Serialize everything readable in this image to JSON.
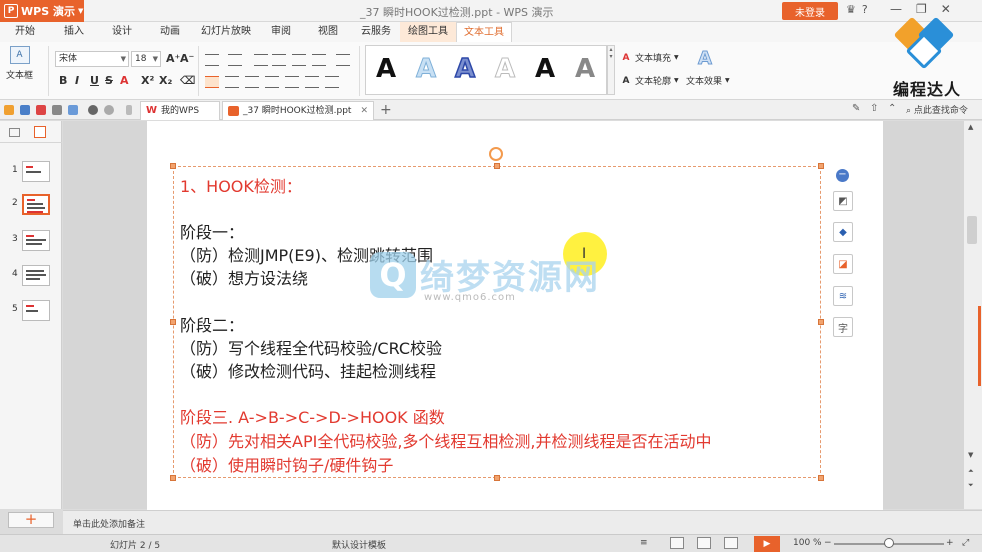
{
  "titlebar": {
    "app_name": "WPS 演示",
    "doc_title": "_37 瞬时HOOK过检测.ppt - WPS 演示",
    "login_label": "未登录",
    "help_label": "?"
  },
  "ribbon_tabs": [
    {
      "label": "开始"
    },
    {
      "label": "插入"
    },
    {
      "label": "设计"
    },
    {
      "label": "动画"
    },
    {
      "label": "幻灯片放映"
    },
    {
      "label": "审阅"
    },
    {
      "label": "视图"
    },
    {
      "label": "云服务"
    },
    {
      "label": "绘图工具"
    },
    {
      "label": "文本工具"
    }
  ],
  "ribbon": {
    "textbox_label": "文本框",
    "font_name": "宋体",
    "font_size": "18",
    "style_sample": "A",
    "text_fill_label": "文本填充",
    "text_outline_label": "文本轮廓",
    "text_effect_label": "文本效果"
  },
  "doc_tabs": {
    "mywps_label": "我的WPS",
    "file_label": "_37 瞬时HOOK过检测.ppt",
    "search_cmd_label": "点此查找命令"
  },
  "thumbnails": [
    "1",
    "2",
    "3",
    "4",
    "5"
  ],
  "slide": {
    "lines": [
      {
        "text": "1、HOOK检测：",
        "color": "red"
      },
      {
        "text": "阶段一：",
        "color": "black"
      },
      {
        "text": "（防）检测JMP(E9)、检测跳转范围",
        "color": "black"
      },
      {
        "text": "（破）想方设法绕",
        "color": "black"
      },
      {
        "text": "阶段二：",
        "color": "black"
      },
      {
        "text": "（防）写个线程全代码校验/CRC校验",
        "color": "black"
      },
      {
        "text": "（破）修改检测代码、挂起检测线程",
        "color": "black"
      },
      {
        "text": "阶段三. A->B->C->D->HOOK 函数",
        "color": "red"
      },
      {
        "text": "（防）先对相关API全代码校验,多个线程互相检测,并检测线程是否在活动中",
        "color": "red"
      },
      {
        "text": "（破）使用瞬时钩子/硬件钩子",
        "color": "red"
      }
    ]
  },
  "watermark": {
    "q": "Q",
    "name": "绮梦资源网",
    "url": "www.qmo6.com"
  },
  "notes_placeholder": "单击此处添加备注",
  "status": {
    "slide_counter": "幻灯片 2 / 5",
    "template": "默认设计模板",
    "zoom": "100 %"
  },
  "brand": {
    "name": "编程达人"
  },
  "colors": {
    "accent": "#e8622b",
    "slide_red": "#e23a30"
  }
}
